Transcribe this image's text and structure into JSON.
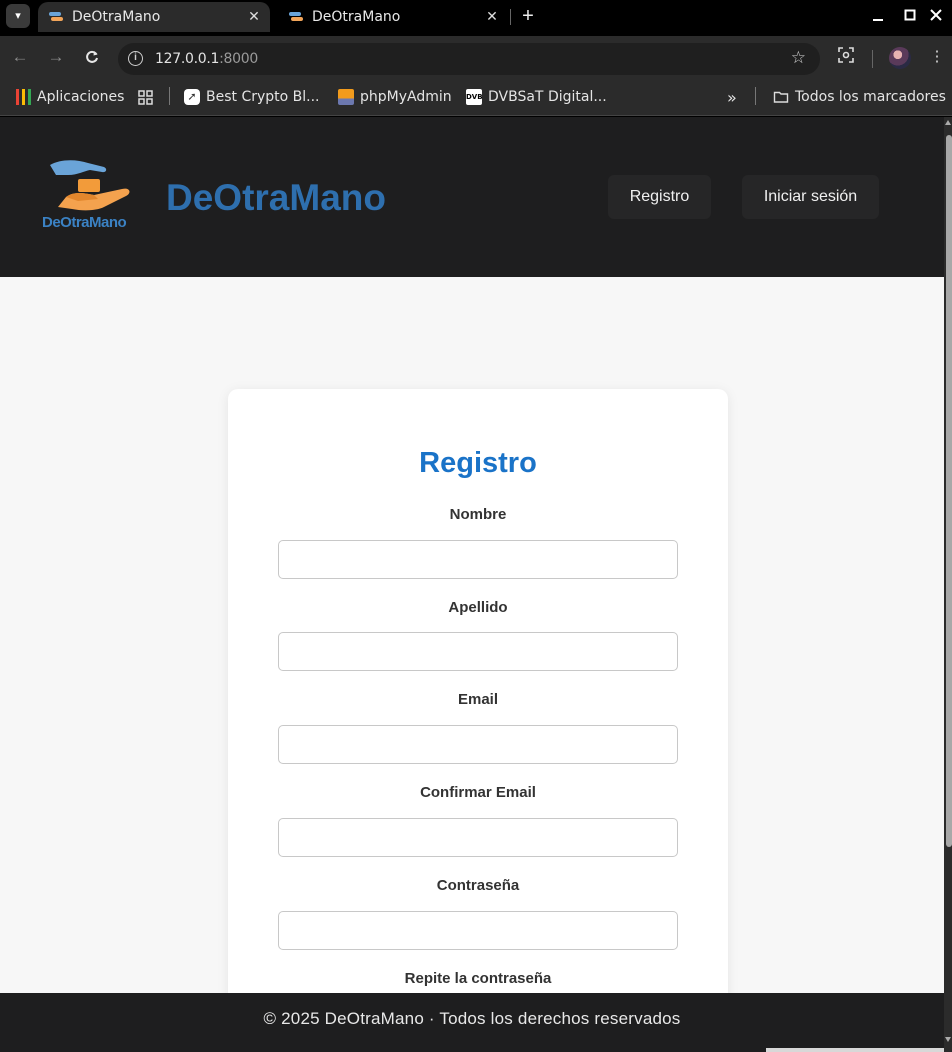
{
  "browser": {
    "tabs": [
      {
        "title": "DeOtraMano",
        "close": "✕"
      },
      {
        "title": "DeOtraMano",
        "close": "✕"
      }
    ],
    "new_tab": "+",
    "url_host": "127.0.0.1",
    "url_port": ":8000",
    "bookmarks": [
      {
        "label": "Aplicaciones"
      },
      {
        "label": "Best Crypto Bl..."
      },
      {
        "label": "phpMyAdmin"
      },
      {
        "label": "DVBSaT Digital..."
      }
    ],
    "overflow": "»",
    "all_bookmarks": "Todos los marcadores"
  },
  "header": {
    "logo_text": "DeOtraMano",
    "brand": "DeOtraMano",
    "register_label": "Registro",
    "login_label": "Iniciar sesión"
  },
  "form": {
    "title": "Registro",
    "fields": [
      {
        "label": "Nombre",
        "value": ""
      },
      {
        "label": "Apellido",
        "value": ""
      },
      {
        "label": "Email",
        "value": ""
      },
      {
        "label": "Confirmar Email",
        "value": ""
      },
      {
        "label": "Contraseña",
        "value": ""
      },
      {
        "label": "Repite la contraseña",
        "value": ""
      }
    ]
  },
  "footer": {
    "text": "© 2025 DeOtraMano · Todos los derechos reservados"
  },
  "colors": {
    "brand_blue": "#2e6fae",
    "title_blue": "#1a73c8",
    "header_bg": "#1e1e1f",
    "page_bg": "#f7f7f7"
  }
}
